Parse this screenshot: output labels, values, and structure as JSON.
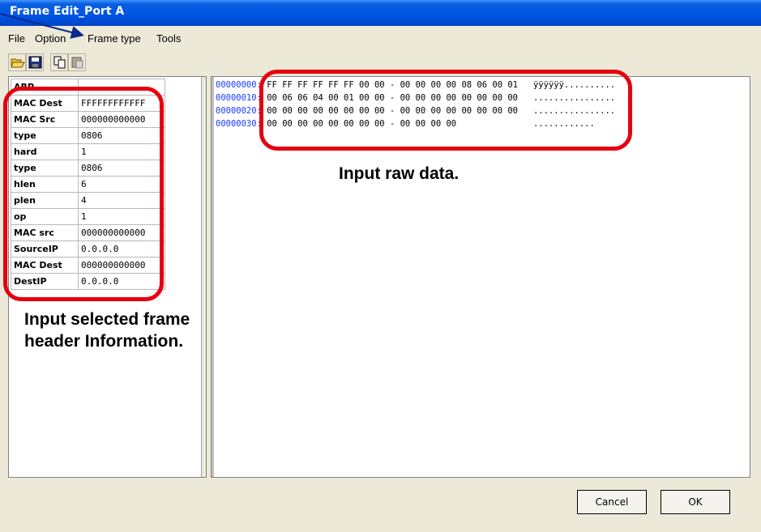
{
  "window": {
    "title": "Frame Edit_Port A"
  },
  "menu": [
    "File",
    "Option",
    "Frame type",
    "Tools"
  ],
  "toolbar": [
    "open-icon",
    "save-icon",
    "copy-icon",
    "paste-icon"
  ],
  "header_table": {
    "first_row": "ARP",
    "rows": [
      {
        "field": "MAC Dest",
        "value": "FFFFFFFFFFFF"
      },
      {
        "field": "MAC Src",
        "value": "000000000000"
      },
      {
        "field": "type",
        "value": "0806"
      },
      {
        "field": "hard",
        "value": "1"
      },
      {
        "field": "type",
        "value": "0806"
      },
      {
        "field": "hlen",
        "value": "6"
      },
      {
        "field": "plen",
        "value": "4"
      },
      {
        "field": "op",
        "value": "1"
      },
      {
        "field": "MAC src",
        "value": "000000000000"
      },
      {
        "field": "SourceIP",
        "value": "0.0.0.0"
      },
      {
        "field": "MAC Dest",
        "value": "000000000000"
      },
      {
        "field": "DestIP",
        "value": "0.0.0.0"
      }
    ]
  },
  "hex_dump": [
    {
      "addr": "00000000:",
      "bytes": "FF FF FF FF FF FF 00 00 - 00 00 00 00 08 06 00 01",
      "ascii": "ÿÿÿÿÿÿ.........."
    },
    {
      "addr": "00000010:",
      "bytes": "00 06 06 04 00 01 00 00 - 00 00 00 00 00 00 00 00",
      "ascii": "................"
    },
    {
      "addr": "00000020:",
      "bytes": "00 00 00 00 00 00 00 00 - 00 00 00 00 00 00 00 00",
      "ascii": "................"
    },
    {
      "addr": "00000030:",
      "bytes": "00 00 00 00 00 00 00 00 - 00 00 00 00",
      "ascii": "............"
    }
  ],
  "buttons": {
    "cancel": "Cancel",
    "ok": "OK"
  },
  "annotations": {
    "raw": "Input raw data.",
    "header_line1": "Input selected frame",
    "header_line2": "header Information."
  },
  "colors": {
    "title_bar": "#0055e5",
    "highlight_ring": "#e50010",
    "address_text": "#1a3cff",
    "arrow": "#0a2a8a"
  }
}
